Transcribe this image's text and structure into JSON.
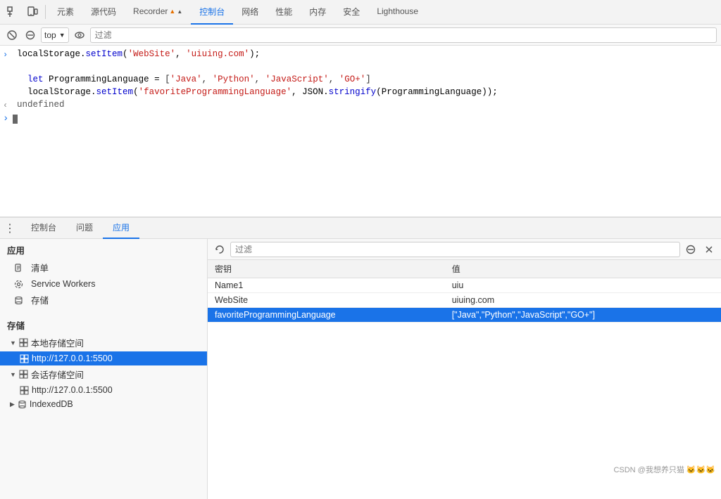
{
  "topNav": {
    "tabs": [
      {
        "label": "元素",
        "active": false
      },
      {
        "label": "源代码",
        "active": false
      },
      {
        "label": "Recorder ▲",
        "active": false
      },
      {
        "label": "控制台",
        "active": true
      },
      {
        "label": "网络",
        "active": false
      },
      {
        "label": "性能",
        "active": false
      },
      {
        "label": "内存",
        "active": false
      },
      {
        "label": "安全",
        "active": false
      },
      {
        "label": "Lighthouse",
        "active": false
      }
    ]
  },
  "toolbar": {
    "frameSelector": "top",
    "filterPlaceholder": "过滤"
  },
  "console": {
    "lines": [
      {
        "type": "input",
        "prompt": ">",
        "content": "localStorage.setItem('WebSite', 'uiuing.com');"
      },
      {
        "type": "blank"
      },
      {
        "type": "input-multi",
        "prompt": "",
        "lines": [
          "let ProgrammingLanguage = ['Java', 'Python', 'JavaScript', 'GO+']",
          "localStorage.setItem('favoriteProgrammingLanguage', JSON.stringify(ProgrammingLanguage));"
        ]
      },
      {
        "type": "output",
        "prompt": "<",
        "content": "undefined"
      }
    ],
    "cursorPrompt": ">"
  },
  "panelTabs": [
    {
      "label": "控制台",
      "active": false
    },
    {
      "label": "问题",
      "active": false
    },
    {
      "label": "应用",
      "active": true
    }
  ],
  "sidebar": {
    "appSectionTitle": "应用",
    "items": [
      {
        "label": "清单",
        "icon": "file"
      },
      {
        "label": "Service Workers",
        "icon": "gear"
      },
      {
        "label": "存储",
        "icon": "cylinder"
      }
    ],
    "storageSectionTitle": "存储",
    "localStorageLabel": "本地存储空间",
    "localStorageUrl": "http://127.0.0.1:5500",
    "sessionStorageLabel": "会话存储空间",
    "sessionStorageUrl": "http://127.0.0.1:5500",
    "indexedDBLabel": "IndexedDB"
  },
  "rightPanel": {
    "filterPlaceholder": "过滤",
    "table": {
      "columns": [
        "密钥",
        "值"
      ],
      "rows": [
        {
          "key": "Name1",
          "value": "uiu",
          "selected": false
        },
        {
          "key": "WebSite",
          "value": "uiuing.com",
          "selected": false
        },
        {
          "key": "favoriteProgrammingLanguage",
          "value": "[\"Java\",\"Python\",\"JavaScript\",\"GO+\"]",
          "selected": true
        }
      ]
    }
  },
  "watermark": "CSDN @我想养只猫 🐱🐱🐱"
}
